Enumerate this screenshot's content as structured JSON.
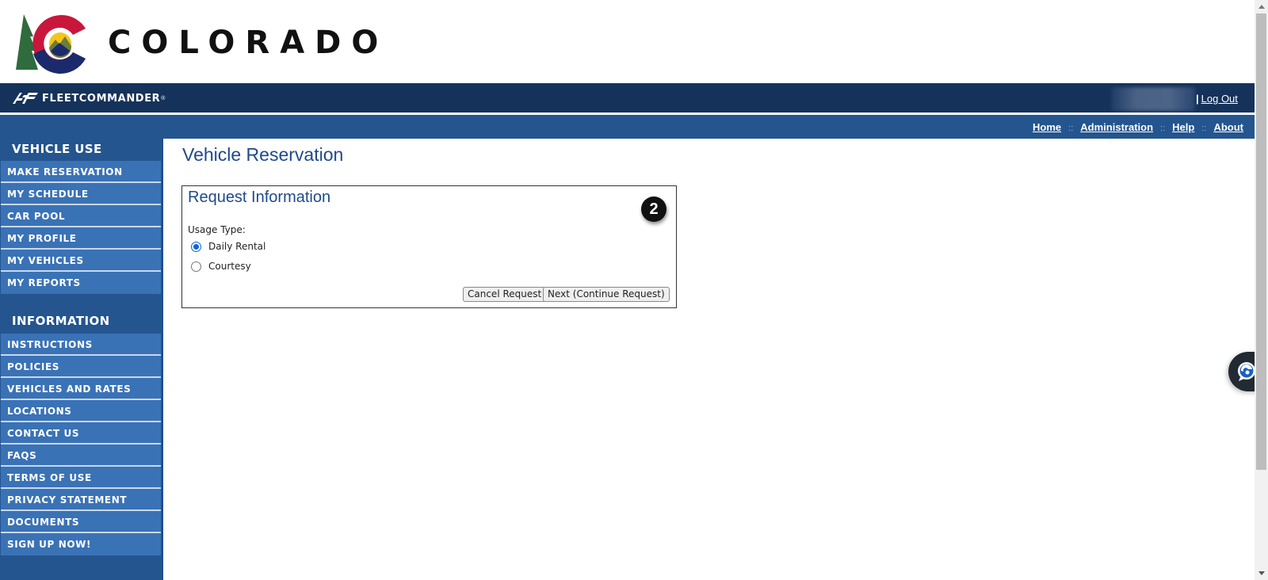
{
  "brand": {
    "state_name": "COLORADO",
    "app_name": "FLEETCOMMANDER",
    "trademark": "®"
  },
  "top_bar": {
    "user_name_redacted": "",
    "separator": "|",
    "logout_label": "Log Out"
  },
  "nav": {
    "links": [
      {
        "label": "Home"
      },
      {
        "label": "Administration"
      },
      {
        "label": "Help"
      },
      {
        "label": "About"
      }
    ],
    "separator": "::"
  },
  "sidebar": {
    "sections": [
      {
        "heading": "VEHICLE USE",
        "items": [
          {
            "label": "MAKE RESERVATION"
          },
          {
            "label": "MY SCHEDULE"
          },
          {
            "label": "CAR POOL"
          },
          {
            "label": "MY PROFILE"
          },
          {
            "label": "MY VEHICLES"
          },
          {
            "label": "MY REPORTS"
          }
        ]
      },
      {
        "heading": "INFORMATION",
        "items": [
          {
            "label": "INSTRUCTIONS"
          },
          {
            "label": "POLICIES"
          },
          {
            "label": "VEHICLES AND RATES"
          },
          {
            "label": "LOCATIONS"
          },
          {
            "label": "CONTACT US"
          },
          {
            "label": "FAQS"
          },
          {
            "label": "TERMS OF USE"
          },
          {
            "label": "PRIVACY STATEMENT"
          },
          {
            "label": "DOCUMENTS"
          },
          {
            "label": "SIGN UP NOW!"
          }
        ]
      }
    ]
  },
  "main": {
    "page_title": "Vehicle Reservation",
    "panel": {
      "title": "Request Information",
      "usage_type_label": "Usage Type:",
      "options": [
        {
          "label": "Daily Rental",
          "checked": true
        },
        {
          "label": "Courtesy",
          "checked": false
        }
      ],
      "cancel_label": "Cancel Request",
      "next_label": "Next (Continue Request)"
    },
    "step_badge": "2"
  },
  "colors": {
    "header_dark": "#15325a",
    "nav_blue": "#24558f",
    "sidebar_item": "#3a72b6",
    "title_blue": "#1f4a8a"
  }
}
